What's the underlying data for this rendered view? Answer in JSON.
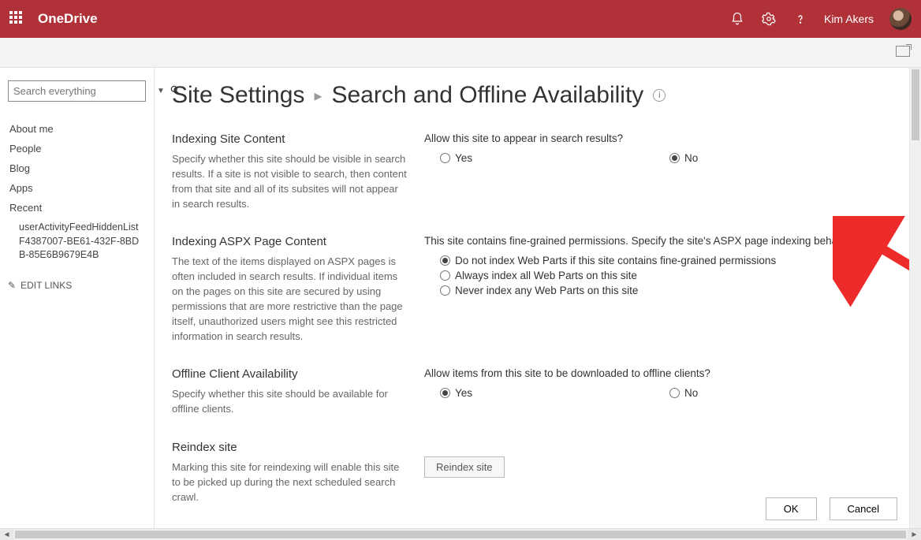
{
  "header": {
    "app_name": "OneDrive",
    "user_name": "Kim Akers"
  },
  "sidebar": {
    "search_placeholder": "Search everything",
    "nav": [
      "About me",
      "People",
      "Blog",
      "Apps",
      "Recent"
    ],
    "recent_item": "userActivityFeedHiddenListF4387007-BE61-432F-8BDB-85E6B9679E4B",
    "edit_links": "EDIT LINKS"
  },
  "page": {
    "breadcrumb_root": "Site Settings",
    "title": "Search and Offline Availability"
  },
  "sections": {
    "indexing_site": {
      "heading": "Indexing Site Content",
      "desc": "Specify whether this site should be visible in search results. If a site is not visible to search, then content from that site and all of its subsites will not appear in search results.",
      "question": "Allow this site to appear in search results?",
      "opt_yes": "Yes",
      "opt_no": "No",
      "selected": "No"
    },
    "indexing_aspx": {
      "heading": "Indexing ASPX Page Content",
      "desc": "The text of the items displayed on ASPX pages is often included in search results. If individual items on the pages on this site are secured by using permissions that are more restrictive than the page itself, unauthorized users might see this restricted information in search results.",
      "question": "This site contains fine-grained permissions. Specify the site's ASPX page indexing behavior:",
      "opt1": "Do not index Web Parts if this site contains fine-grained permissions",
      "opt2": "Always index all Web Parts on this site",
      "opt3": "Never index any Web Parts on this site",
      "selected": "opt1"
    },
    "offline": {
      "heading": "Offline Client Availability",
      "desc": "Specify whether this site should be available for offline clients.",
      "question": "Allow items from this site to be downloaded to offline clients?",
      "opt_yes": "Yes",
      "opt_no": "No",
      "selected": "Yes"
    },
    "reindex": {
      "heading": "Reindex site",
      "desc": "Marking this site for reindexing will enable this site to be picked up during the next scheduled search crawl.",
      "button": "Reindex site"
    }
  },
  "buttons": {
    "ok": "OK",
    "cancel": "Cancel"
  }
}
